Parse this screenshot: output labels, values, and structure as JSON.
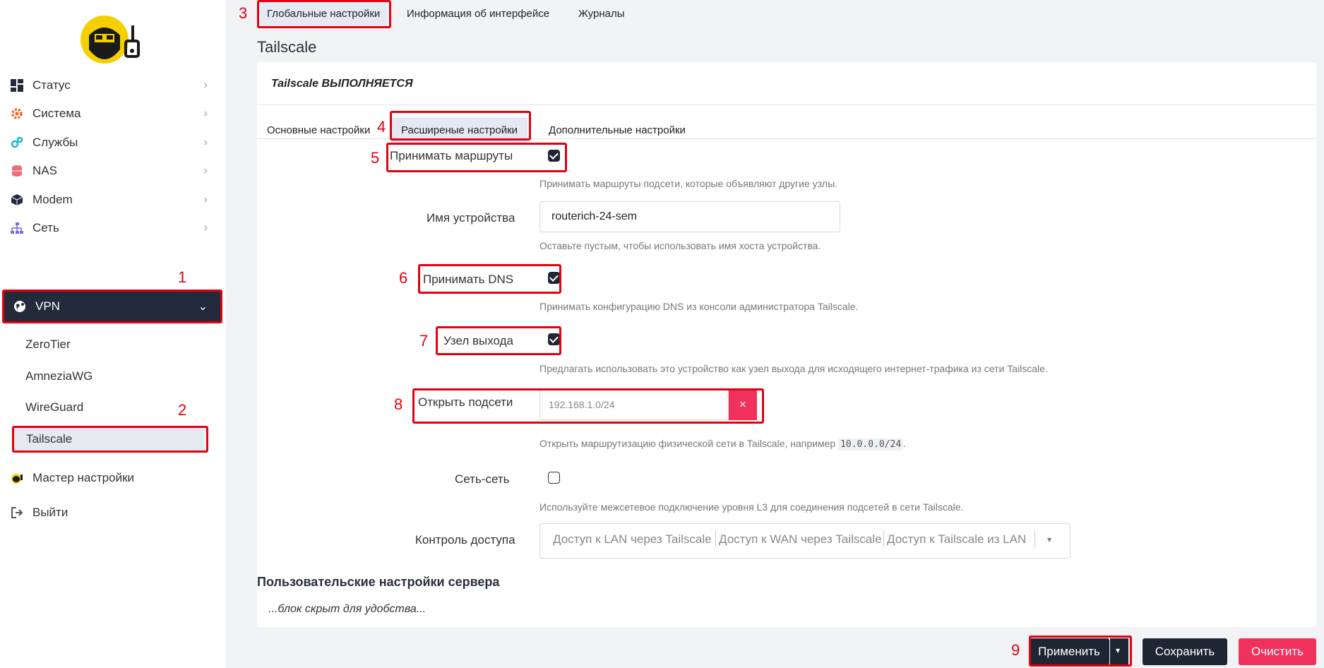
{
  "sidebar": {
    "items": [
      {
        "label": "Статус",
        "icon": "dashboard-icon"
      },
      {
        "label": "Система",
        "icon": "gear-icon"
      },
      {
        "label": "Службы",
        "icon": "services-icon"
      },
      {
        "label": "NAS",
        "icon": "database-icon"
      },
      {
        "label": "Modem",
        "icon": "cube-icon"
      },
      {
        "label": "Сеть",
        "icon": "network-icon"
      },
      {
        "label": "VPN",
        "icon": "globe-icon"
      }
    ],
    "vpn_sub": [
      "ZeroTier",
      "AmneziaWG",
      "WireGuard",
      "Tailscale"
    ],
    "wizard": "Мастер настройки",
    "logout": "Выйти"
  },
  "top_tabs": [
    "Глобальные настройки",
    "Информация об интерфейсе",
    "Журналы"
  ],
  "page_title": "Tailscale",
  "status": "Tailscale ВЫПОЛНЯЕТСЯ",
  "sub_tabs": [
    "Основные настройки",
    "Расширеные настройки",
    "Дополнительные настройки"
  ],
  "form": {
    "accept_routes": {
      "label": "Принимать маршруты",
      "checked": true,
      "hint": "Принимать маршруты подсети, которые объявляют другие узлы."
    },
    "hostname": {
      "label": "Имя устройства",
      "value": "routerich-24-sem",
      "hint": "Оставьте пустым, чтобы использовать имя хоста устройства."
    },
    "accept_dns": {
      "label": "Принимать DNS",
      "checked": true,
      "hint": "Принимать конфигурацию DNS из консоли администратора Tailscale."
    },
    "exit_node": {
      "label": "Узел выхода",
      "checked": true,
      "hint": "Предлагать использовать это устройство как узел выхода для исходящего интернет-трафика из сети Tailscale."
    },
    "advertise_routes": {
      "label": "Открыть подсети",
      "placeholder": "192.168.1.0/24",
      "remove": "×",
      "hint_before": "Открыть маршрутизацию физической сети в Tailscale, например ",
      "hint_code": "10.0.0.0/24",
      "hint_after": "."
    },
    "s2s": {
      "label": "Сеть-сеть",
      "checked": false,
      "hint": "Используйте межсетевое подключение уровня L3 для соединения подсетей в сети Tailscale."
    },
    "access": {
      "label": "Контроль доступа",
      "options": [
        "Доступ к LAN через Tailscale",
        "Доступ к WAN через Tailscale",
        "Доступ к Tailscale из LAN"
      ],
      "arrow": "▾"
    }
  },
  "server_section": {
    "title": "Пользовательские настройки сервера",
    "note": "...блок скрыт для удобства..."
  },
  "footer": {
    "apply": "Применить",
    "apply_arrow": "▾",
    "save": "Сохранить",
    "reset": "Очистить"
  },
  "annotations": [
    "1",
    "2",
    "3",
    "4",
    "5",
    "6",
    "7",
    "8",
    "9"
  ],
  "colors": {
    "accent_dark": "#1f2633",
    "danger": "#f0315c",
    "annotation": "#e3000f"
  }
}
